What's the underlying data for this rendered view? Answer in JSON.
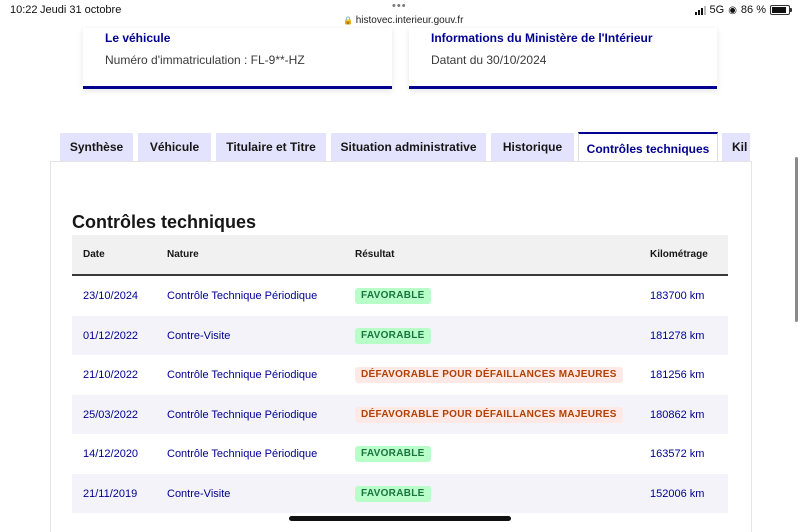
{
  "statusbar": {
    "time": "10:22",
    "date": "Jeudi 31 octobre",
    "dots": "•••",
    "lock_glyph": "🔒",
    "url": "histovec.interieur.gouv.fr",
    "network": "5G",
    "battery_text": "86 %",
    "battery_level": 0.86
  },
  "cards": {
    "vehicle": {
      "title": "Le véhicule",
      "value": "Numéro d'immatriculation : FL-9**-HZ"
    },
    "ministry": {
      "title": "Informations du Ministère de l'Intérieur",
      "value": "Datant du 30/10/2024"
    }
  },
  "tabs": [
    {
      "label": "Synthèse",
      "active": false
    },
    {
      "label": "Véhicule",
      "active": false
    },
    {
      "label": "Titulaire et Titre",
      "active": false
    },
    {
      "label": "Situation administrative",
      "active": false
    },
    {
      "label": "Historique",
      "active": false
    },
    {
      "label": "Contrôles techniques",
      "active": true
    },
    {
      "label": "Kil",
      "active": false
    }
  ],
  "section_title": "Contrôles techniques",
  "table": {
    "headers": {
      "date": "Date",
      "nature": "Nature",
      "result": "Résultat",
      "km": "Kilométrage"
    },
    "rows": [
      {
        "date": "23/10/2024",
        "nature": "Contrôle Technique Périodique",
        "result": "FAVORABLE",
        "status": "ok",
        "km": "183700 km"
      },
      {
        "date": "01/12/2022",
        "nature": "Contre-Visite",
        "result": "FAVORABLE",
        "status": "ok",
        "km": "181278 km"
      },
      {
        "date": "21/10/2022",
        "nature": "Contrôle Technique Périodique",
        "result": "DÉFAVORABLE POUR DÉFAILLANCES MAJEURES",
        "status": "ko",
        "km": "181256 km"
      },
      {
        "date": "25/03/2022",
        "nature": "Contrôle Technique Périodique",
        "result": "DÉFAVORABLE POUR DÉFAILLANCES MAJEURES",
        "status": "ko",
        "km": "180862 km"
      },
      {
        "date": "14/12/2020",
        "nature": "Contrôle Technique Périodique",
        "result": "FAVORABLE",
        "status": "ok",
        "km": "163572 km"
      },
      {
        "date": "21/11/2019",
        "nature": "Contre-Visite",
        "result": "FAVORABLE",
        "status": "ok",
        "km": "152006 km"
      }
    ]
  },
  "colors": {
    "primary": "#000091",
    "tab_inactive": "#e3e3fd",
    "badge_ok_bg": "#b8fec9",
    "badge_ok_text": "#18753c",
    "badge_ko_bg": "#ffe9e6",
    "badge_ko_text": "#b34000",
    "row_alt": "#f3f3f9"
  }
}
